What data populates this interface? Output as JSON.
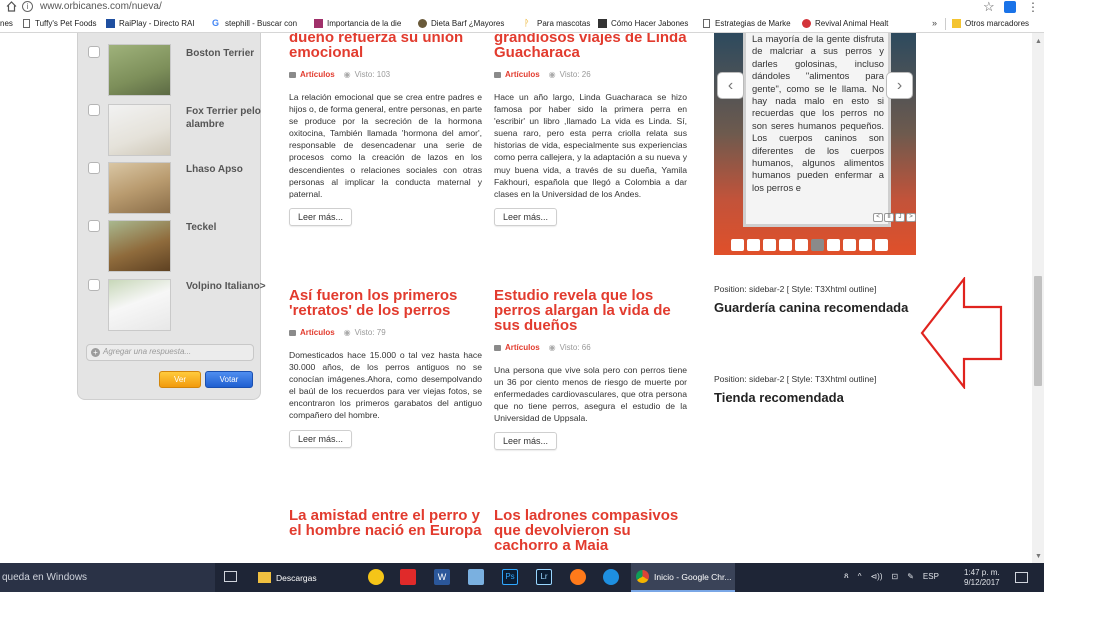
{
  "browser": {
    "url": "www.orbicanes.com/nueva/",
    "info_glyph": "i",
    "star_glyph": "☆",
    "kebab_glyph": "⋮",
    "bookmarks": [
      {
        "label": "nes",
        "icon": "none"
      },
      {
        "label": "Tuffy's Pet Foods",
        "icon": "page-icon"
      },
      {
        "label": "RaiPlay - Directo RAI",
        "icon": "rai-icon"
      },
      {
        "label": "stephill - Buscar con",
        "icon": "google-icon"
      },
      {
        "label": "Importancia de la die",
        "icon": "bookmark-icon"
      },
      {
        "label": "Dieta Barf ¿Mayores",
        "icon": "bookmark-icon"
      },
      {
        "label": "Para mascotas",
        "icon": "bookmark-icon"
      },
      {
        "label": "Cómo Hacer Jabones",
        "icon": "bookmark-icon"
      },
      {
        "label": "Estrategias de Marke",
        "icon": "page-icon"
      },
      {
        "label": "Revival Animal Healt",
        "icon": "bookmark-icon"
      }
    ],
    "chevron": "»",
    "other_bookmarks": "Otros marcadores"
  },
  "poll": {
    "items": [
      {
        "label": "Boston Terrier",
        "image": "boston-terrier-photo"
      },
      {
        "label": "Fox Terrier pelo alambre",
        "image": "fox-terrier-photo"
      },
      {
        "label": "Lhaso Apso",
        "image": "lhasa-apso-photo"
      },
      {
        "label": "Teckel",
        "image": "teckel-photo"
      },
      {
        "label": "Volpino Italiano>",
        "image": "volpino-photo"
      }
    ],
    "answer_placeholder": "Agregar una respuesta...",
    "plus_glyph": "+",
    "view_label": "Ver",
    "vote_label": "Votar"
  },
  "articles": [
    {
      "title": "dueño refuerza su unión emocional",
      "category": "Artículos",
      "views": "Visto: 103",
      "body": "La relación emocional que se crea entre padres e hijos o, de forma general, entre personas, en parte se produce por la secreción de la hormona oxitocina, También llamada 'hormona del amor', responsable de desencadenar una serie de procesos como la creación de lazos en los descendientes o relaciones sociales con otras personas al implicar la conducta maternal y paternal.",
      "button": "Leer más..."
    },
    {
      "title": "grandiosos viajes de Linda Guacharaca",
      "category": "Artículos",
      "views": "Visto: 26",
      "body": "Hace un año largo, Linda Guacharaca se hizo famosa por haber sido la primera perra en 'escribir' un libro ,llamado La vida es Linda. Sí, suena raro, pero esta perra criolla relata sus historias de vida, especialmente sus experiencias como perra callejera, y la adaptación a su nueva y muy buena vida, a través de su dueña, Yamila Fakhouri, española que llegó a Colombia a dar clases en la Universidad de los Andes.",
      "button": "Leer más..."
    },
    {
      "title": "Así fueron los primeros 'retratos' de los perros",
      "category": "Artículos",
      "views": "Visto: 79",
      "body": "Domesticados hace 15.000 o tal vez hasta hace 30.000 años, de los perros antiguos no se conocían imágenes.Ahora, como desempolvando el baúl de los recuerdos para ver viejas fotos, se encontraron los primeros garabatos del antiguo compañero del hombre.",
      "button": "Leer más..."
    },
    {
      "title": "Estudio revela que los perros alargan la vida de sus dueños",
      "category": "Artículos",
      "views": "Visto: 66",
      "body": "Una persona que vive sola pero con perros tiene un 36 por ciento menos de riesgo de muerte por enfermedades cardiovasculares, que otra persona que no tiene perros, asegura el estudio de la Universidad de Uppsala.",
      "button": "Leer más..."
    },
    {
      "title": "La amistad entre el perro y el hombre nació en Europa"
    },
    {
      "title": "Los ladrones compasivos que devolvieron su cachorro a Maia"
    }
  ],
  "slider": {
    "text": "La mayoría de la gente disfruta de malcriar a sus perros y darles golosinas, incluso dándoles \"alimentos para gente\", como se le llama. No hay nada malo en esto si recuerdas que los perros no son seres humanos pequeños. Los cuerpos caninos son diferentes de los cuerpos humanos, algunos alimentos humanos pueden enfermar a los perros e",
    "prev_glyph": "‹",
    "next_glyph": "›",
    "mini_nav": [
      "<",
      "II",
      "J",
      ">"
    ],
    "dot_count": 10,
    "active_dot": 5
  },
  "sidebar": {
    "modules": [
      {
        "position": "Position: sidebar-2 [ Style: T3Xhtml outline]",
        "title": "Guardería canina recomendada"
      },
      {
        "position": "Position: sidebar-2 [ Style: T3Xhtml outline]",
        "title": "Tienda recomendada"
      }
    ]
  },
  "taskbar": {
    "search_text": "queda en Windows",
    "apps": [
      {
        "label": "Descargas",
        "icon": "folder-icon"
      },
      {
        "label": "Inicio - Google Chr...",
        "icon": "chrome-icon"
      }
    ],
    "pinned_icons": [
      "norton-icon",
      "security-icon",
      "word-icon",
      "notepad-icon",
      "photoshop-icon",
      "lightroom-icon",
      "firefox-icon",
      "edge-icon"
    ],
    "photoshop_label": "Ps",
    "lightroom_label": "Lr",
    "word_label": "W",
    "tray_language": "ESP",
    "tray_glyphs": [
      "ጸ",
      "^",
      "⊲))",
      "⊡",
      "✎"
    ],
    "time": "1:47 p. m.",
    "date": "9/12/2017"
  },
  "colors": {
    "accent_red": "#e23b2e",
    "taskbar": "#1e2536",
    "btn_yellow": "#f29a0c",
    "btn_blue": "#1f5fd0"
  }
}
